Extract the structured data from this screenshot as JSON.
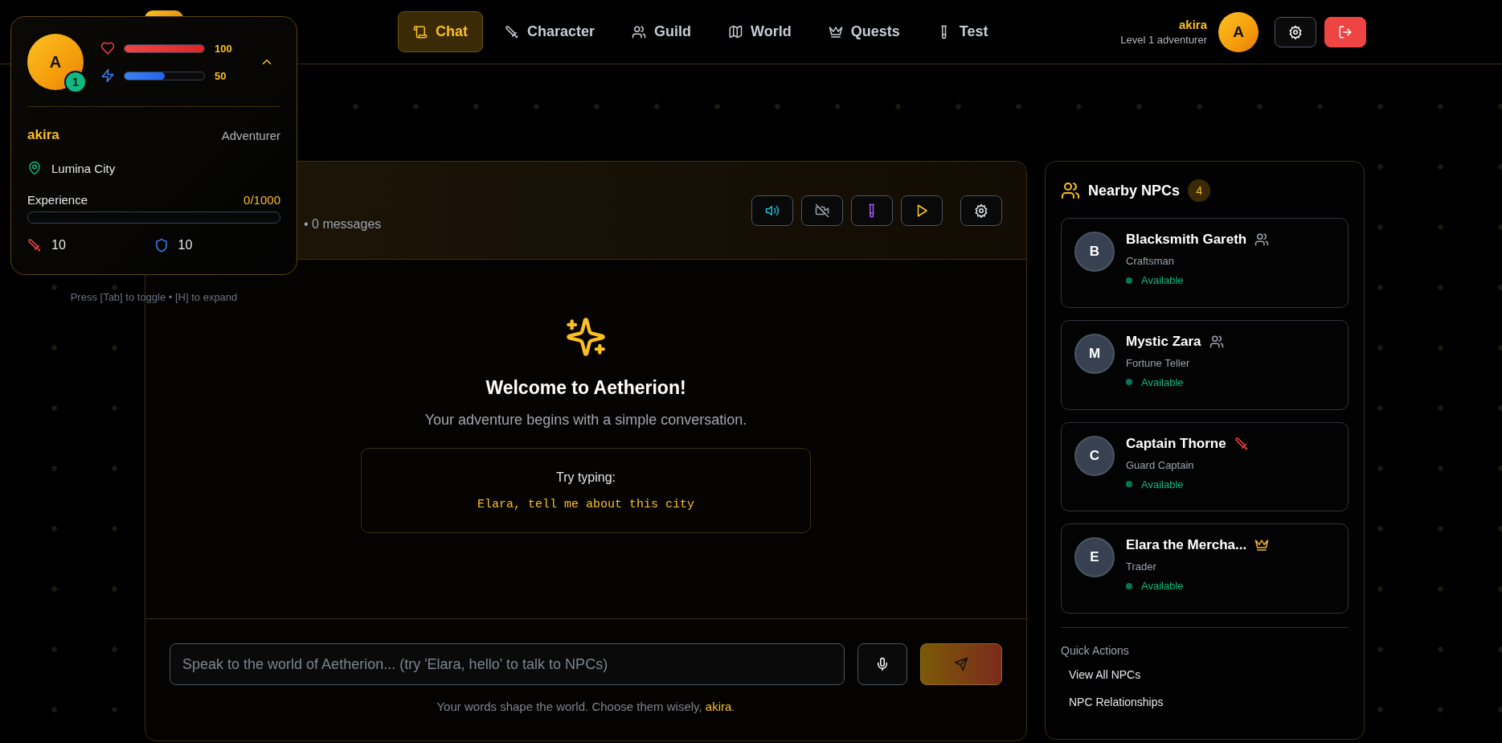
{
  "header": {
    "nav": [
      {
        "label": "Chat",
        "selected": true
      },
      {
        "label": "Character",
        "selected": false
      },
      {
        "label": "Guild",
        "selected": false
      },
      {
        "label": "World",
        "selected": false
      },
      {
        "label": "Quests",
        "selected": false
      },
      {
        "label": "Test",
        "selected": false
      }
    ],
    "user": {
      "name": "akira",
      "subtitle": "Level 1 adventurer",
      "avatar": "A"
    }
  },
  "player_card": {
    "avatar": "A",
    "player_level": "1",
    "expanded": true,
    "health": {
      "level": 1,
      "value": "100"
    },
    "energy": {
      "level": 0.5,
      "value": "50"
    },
    "name": "akira",
    "class_name": "Adventurer",
    "location": "Lumina City",
    "experience": {
      "label": "Experience",
      "value": "0/1000",
      "level": 0
    },
    "attack": "10",
    "defense": "10"
  },
  "hint": "Press [Tab] to toggle • [H] to expand",
  "chat": {
    "subtitle": "• 0 messages",
    "controls": [
      {
        "kind": "sound"
      },
      {
        "kind": "video-off"
      },
      {
        "kind": "test"
      },
      {
        "kind": "play"
      },
      {
        "kind": "settings"
      }
    ],
    "welcome": {
      "title": "Welcome to Aetherion!",
      "text": "Your adventure begins with a simple conversation.",
      "try_label": "Try typing:",
      "example": "Elara, tell me about this city"
    },
    "input": {
      "placeholder": "Speak to the world of Aetherion... (try 'Elara, hello' to talk to NPCs)"
    },
    "footer": {
      "text": "Your words shape the world. Choose them wisely,",
      "name": "akira",
      "end": "."
    }
  },
  "npcs": {
    "title": "Nearby NPCs",
    "count": "4",
    "items": [
      {
        "initial": "B",
        "name": "Blacksmith Gareth",
        "role": "Craftsman",
        "status": "Available"
      },
      {
        "initial": "M",
        "name": "Mystic Zara",
        "role": "Fortune Teller",
        "status": "Available"
      },
      {
        "initial": "C",
        "name": "Captain Thorne",
        "role": "Guard Captain",
        "status": "Available"
      },
      {
        "initial": "E",
        "name": "Elara the Mercha...",
        "role": "Trader",
        "status": "Available"
      }
    ],
    "quick_actions": {
      "title": "Quick Actions",
      "items": [
        "View All NPCs",
        "NPC Relationships"
      ]
    }
  }
}
